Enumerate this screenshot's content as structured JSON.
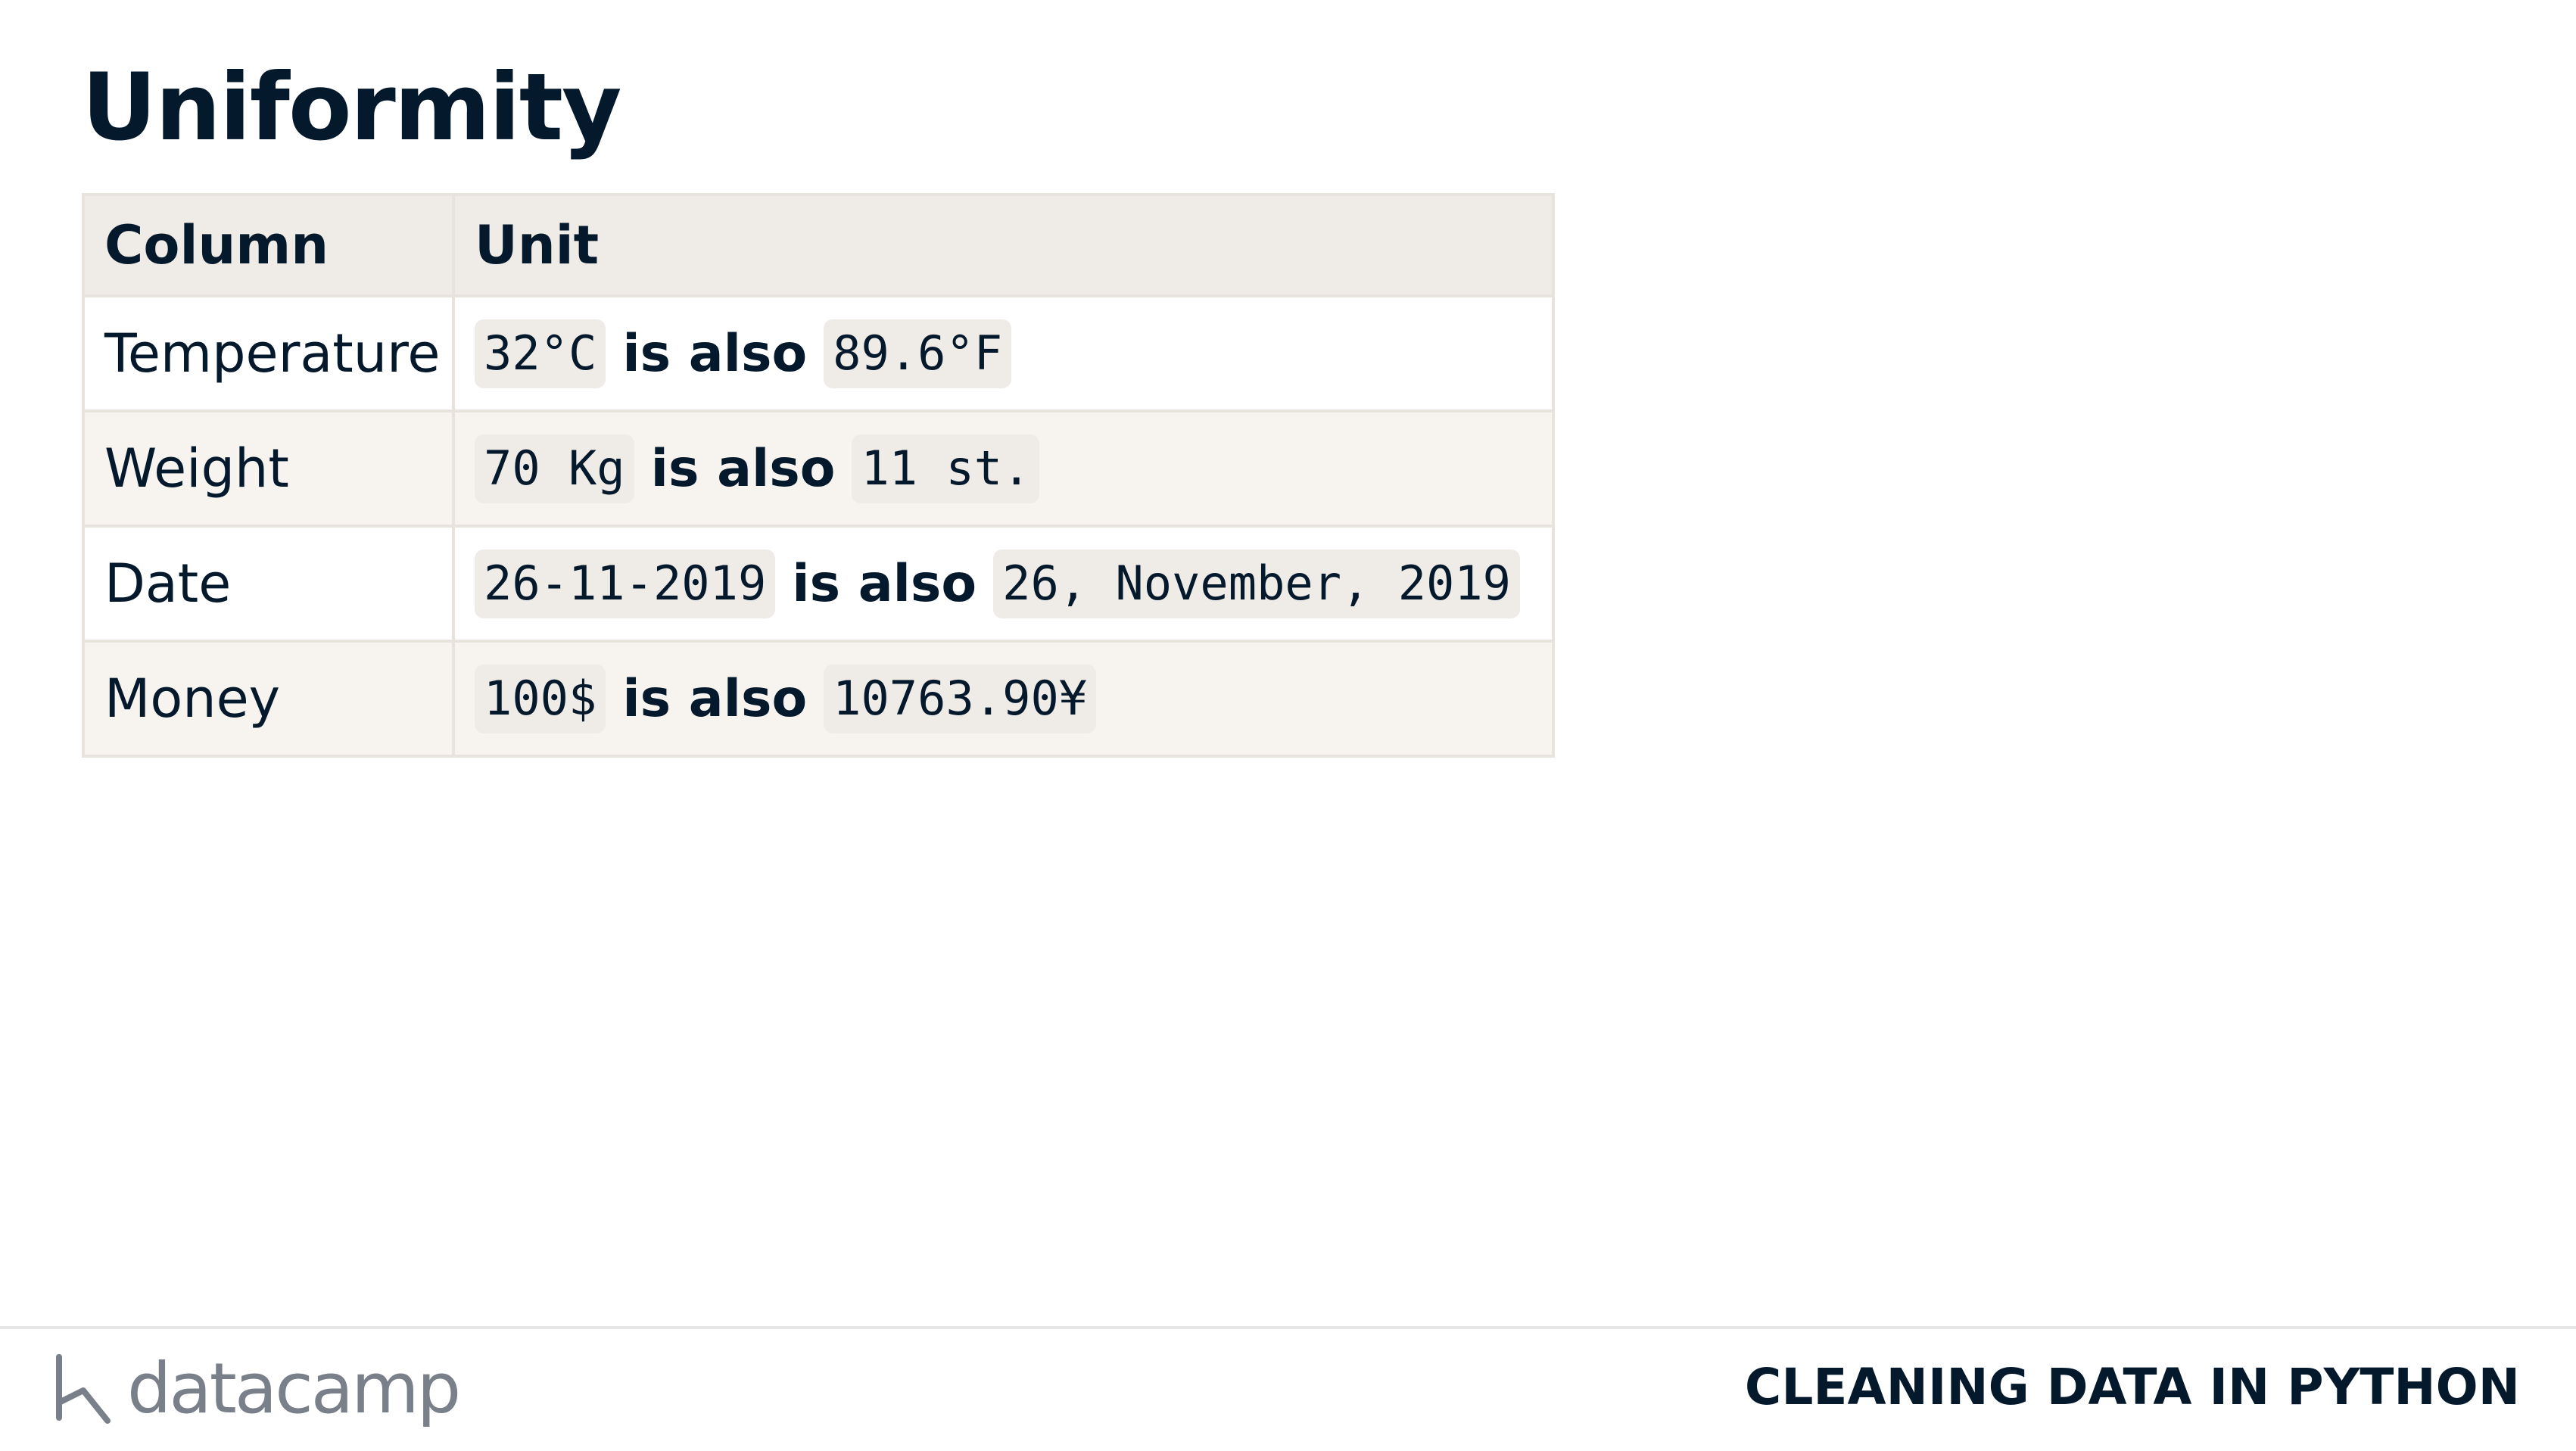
{
  "slide": {
    "title": "Uniformity"
  },
  "table": {
    "headers": [
      "Column",
      "Unit"
    ],
    "rows": [
      {
        "column": "Temperature",
        "value_a": "32°C",
        "joiner": "is also",
        "value_b": "89.6°F"
      },
      {
        "column": "Weight",
        "value_a": "70 Kg",
        "joiner": "is also",
        "value_b": "11 st."
      },
      {
        "column": "Date",
        "value_a": "26-11-2019",
        "joiner": "is also",
        "value_b": "26, November, 2019"
      },
      {
        "column": "Money",
        "value_a": "100$",
        "joiner": "is also",
        "value_b": "10763.90¥"
      }
    ]
  },
  "footer": {
    "brand": "datacamp",
    "brand_icon": "datacamp-logo-icon",
    "course": "CLEANING DATA IN PYTHON"
  },
  "colors": {
    "text": "#05192d",
    "header_bg": "#efebe6",
    "row_tint": "#f7f4ef",
    "border": "#e8e3dd",
    "brand_gray": "#7a8089"
  }
}
